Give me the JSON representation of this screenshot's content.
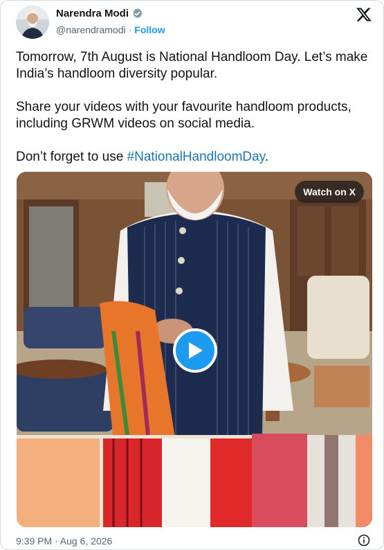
{
  "author": {
    "name": "Narendra Modi",
    "handle": "@narendramodi",
    "separator": "·",
    "follow_label": "Follow",
    "verified_color": "#829aab"
  },
  "post": {
    "line1": "Tomorrow, 7th August is National Handloom Day. Let’s make India’s handloom diversity popular.",
    "line2": "Share your videos with your favourite handloom products, including GRWM videos on social media.",
    "line3_prefix": "Don’t forget to use ",
    "hashtag": "#NationalHandloomDay",
    "line3_suffix": "."
  },
  "media": {
    "watch_label": "Watch on X",
    "play_icon": "play-icon"
  },
  "meta": {
    "timestamp": "9:39 PM · Aug 6, 2026",
    "info_icon": "info-icon"
  },
  "icons": {
    "logo": "x-logo-icon",
    "verified": "verified-badge-icon"
  },
  "colors": {
    "accent": "#1d9bf0",
    "hashtag": "#1d73b6",
    "text": "#0f1419",
    "muted": "#536471"
  }
}
